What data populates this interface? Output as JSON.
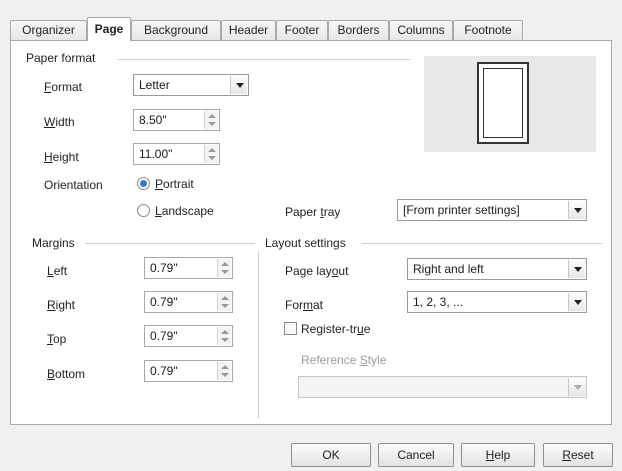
{
  "tabs": [
    {
      "label": "Organizer",
      "active": false
    },
    {
      "label": "Page",
      "active": true
    },
    {
      "label": "Background",
      "active": false
    },
    {
      "label": "Header",
      "active": false
    },
    {
      "label": "Footer",
      "active": false
    },
    {
      "label": "Borders",
      "active": false
    },
    {
      "label": "Columns",
      "active": false
    },
    {
      "label": "Footnote",
      "active": false
    }
  ],
  "paper_format": {
    "title": "Paper format",
    "format_label": "Format",
    "format_value": "Letter",
    "width_label": "Width",
    "width_value": "8.50\"",
    "height_label": "Height",
    "height_value": "11.00\"",
    "orientation_label": "Orientation",
    "portrait_label": "Portrait",
    "landscape_label": "Landscape",
    "orientation_selected": "Portrait",
    "paper_tray_label": "Paper tray",
    "paper_tray_value": "[From printer settings]"
  },
  "margins": {
    "title": "Margins",
    "left_label": "Left",
    "left_value": "0.79\"",
    "right_label": "Right",
    "right_value": "0.79\"",
    "top_label": "Top",
    "top_value": "0.79\"",
    "bottom_label": "Bottom",
    "bottom_value": "0.79\""
  },
  "layout_settings": {
    "title": "Layout settings",
    "page_layout_label": "Page layout",
    "page_layout_value": "Right and left",
    "format_label": "Format",
    "format_value": "1, 2, 3, ...",
    "register_true_label": "Register-true",
    "register_true_checked": false,
    "reference_style_label": "Reference Style",
    "reference_style_value": ""
  },
  "buttons": {
    "ok": "OK",
    "cancel": "Cancel",
    "help": "Help",
    "reset": "Reset"
  }
}
